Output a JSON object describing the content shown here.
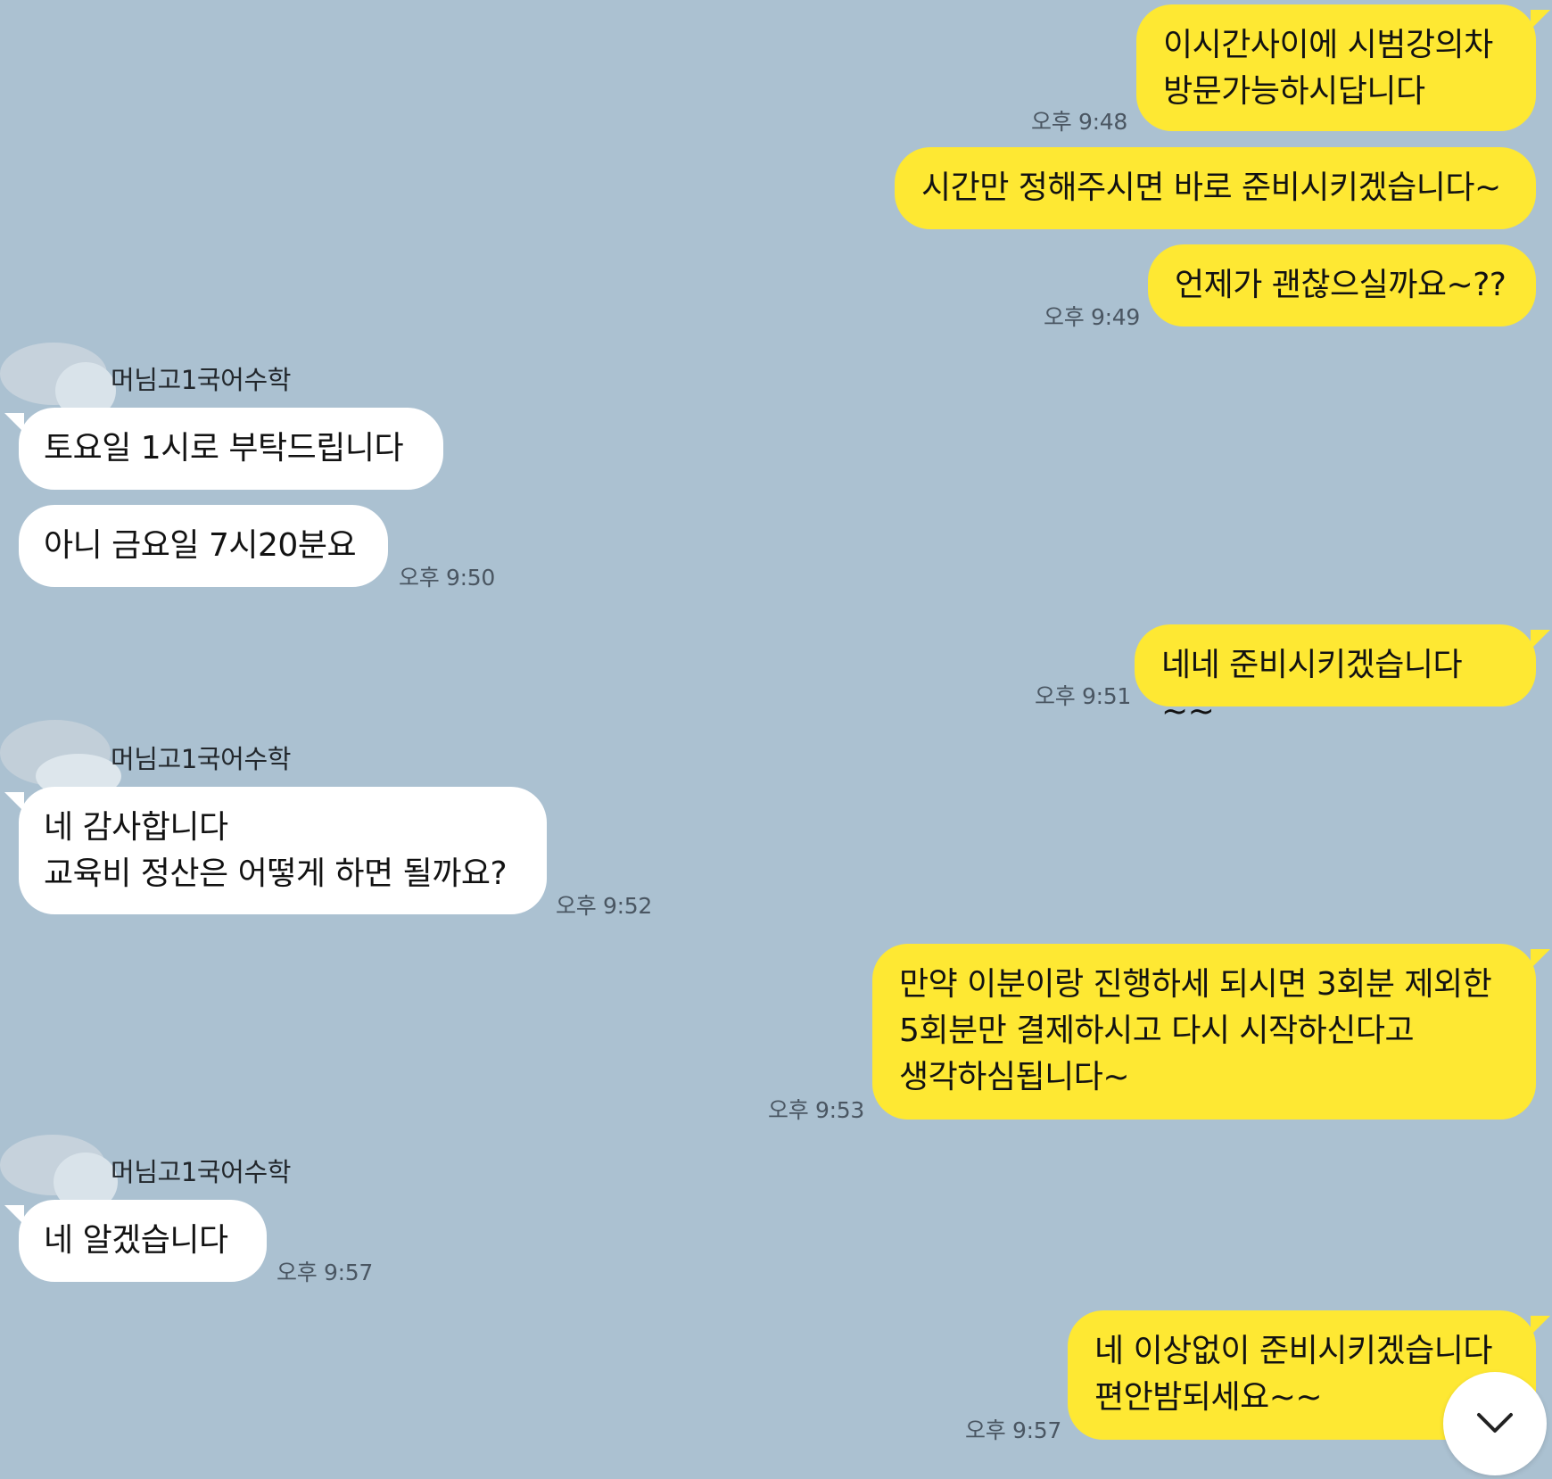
{
  "conversation": {
    "sender_name": "머님고1국어수학",
    "messages": [
      {
        "from": "me",
        "text": "이시간사이에 시범강의차\n방문가능하시답니다",
        "time": "오후 9:48"
      },
      {
        "from": "me",
        "text": "시간만 정해주시면 바로 준비시키겠습니다~",
        "time": ""
      },
      {
        "from": "me",
        "text": "언제가 괜찮으실까요~??",
        "time": "오후 9:49"
      },
      {
        "from": "other",
        "text": "토요일 1시로 부탁드립니다",
        "time": ""
      },
      {
        "from": "other",
        "text": "아니 금요일 7시20분요",
        "time": "오후 9:50"
      },
      {
        "from": "me",
        "text": "네네 준비시키겠습니다~~",
        "time": "오후 9:51"
      },
      {
        "from": "other",
        "text": "네 감사합니다\n교육비 정산은 어떻게 하면 될까요?",
        "time": "오후 9:52"
      },
      {
        "from": "me",
        "text": "만약 이분이랑 진행하세 되시면 3회분 제외한\n5회분만 결제하시고 다시 시작하신다고\n생각하심됩니다~",
        "time": "오후 9:53"
      },
      {
        "from": "other",
        "text": "네 알겠습니다",
        "time": "오후 9:57"
      },
      {
        "from": "me",
        "text": "네 이상없이 준비시키겠습니다\n편안밤되세요~~",
        "time": "오후 9:57"
      }
    ]
  },
  "scroll_down_button": {
    "icon": "chevron-down-icon"
  },
  "colors": {
    "background": "#abc1d1",
    "my_bubble": "#fee833",
    "their_bubble": "#ffffff",
    "time_text": "#4a5662"
  }
}
